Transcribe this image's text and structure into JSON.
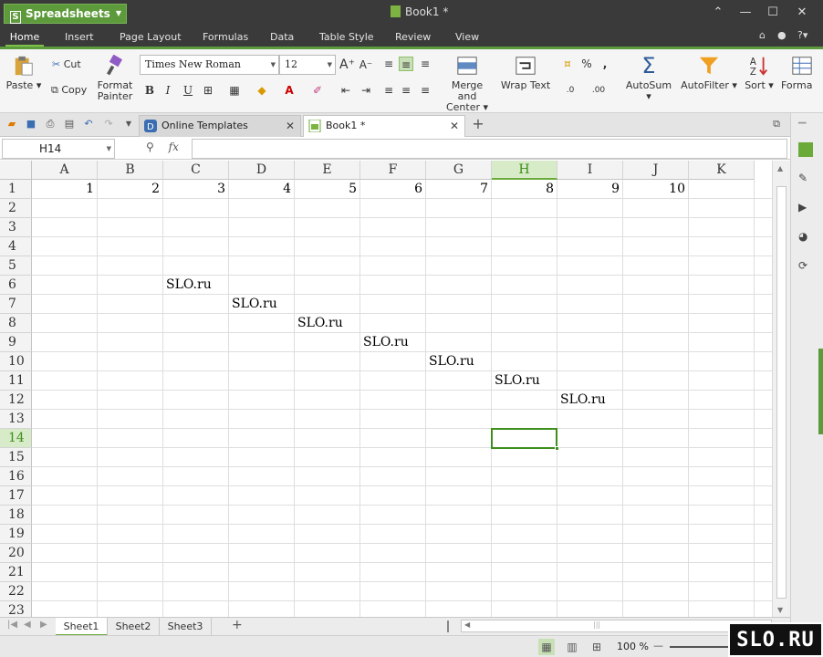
{
  "app": {
    "name": "Spreadsheets",
    "document_title": "Book1 *"
  },
  "menu": {
    "tabs": [
      "Home",
      "Insert",
      "Page Layout",
      "Formulas",
      "Data",
      "Table Style",
      "Review",
      "View"
    ],
    "help": "?"
  },
  "ribbon": {
    "paste": "Paste",
    "cut": "Cut",
    "copy": "Copy",
    "format_painter_1": "Format",
    "format_painter_2": "Painter",
    "font_name": "Times New Roman",
    "font_size": "12",
    "bold": "B",
    "italic": "I",
    "underline": "U",
    "merge_1": "Merge and",
    "merge_2": "Center",
    "wrap": "Wrap Text",
    "percent": "%",
    "comma": ",",
    "autosum": "AutoSum",
    "autofilter": "AutoFilter",
    "sort": "Sort",
    "format": "Forma"
  },
  "tabs": [
    {
      "label": "Online Templates"
    },
    {
      "label": "Book1 *"
    }
  ],
  "formula_bar": {
    "name_box": "H14",
    "fx": "fx",
    "formula": ""
  },
  "grid": {
    "columns": [
      "A",
      "B",
      "C",
      "D",
      "E",
      "F",
      "G",
      "H",
      "I",
      "J",
      "K"
    ],
    "rows": [
      "1",
      "2",
      "3",
      "4",
      "5",
      "6",
      "7",
      "8",
      "9",
      "10",
      "11",
      "12",
      "13",
      "14",
      "15",
      "16",
      "17",
      "18",
      "19",
      "20",
      "21",
      "22",
      "23"
    ],
    "selected_column": "H",
    "selected_row": "14",
    "row1_values": [
      "1",
      "2",
      "3",
      "4",
      "5",
      "6",
      "7",
      "8",
      "9",
      "10"
    ],
    "text_cells": [
      {
        "row": "6",
        "col": "C",
        "value": "SLO.ru"
      },
      {
        "row": "7",
        "col": "D",
        "value": "SLO.ru"
      },
      {
        "row": "8",
        "col": "E",
        "value": "SLO.ru"
      },
      {
        "row": "9",
        "col": "F",
        "value": "SLO.ru"
      },
      {
        "row": "10",
        "col": "G",
        "value": "SLO.ru"
      },
      {
        "row": "11",
        "col": "H",
        "value": "SLO.ru"
      },
      {
        "row": "12",
        "col": "I",
        "value": "SLO.ru"
      }
    ]
  },
  "sheets": [
    "Sheet1",
    "Sheet2",
    "Sheet3"
  ],
  "active_sheet": "Sheet1",
  "status": {
    "zoom": "100 %"
  },
  "watermark": "SLO.RU",
  "colors": {
    "accent": "#5d9a3b",
    "titlebar": "#3a3a3a",
    "selection": "#3e8e1e"
  }
}
